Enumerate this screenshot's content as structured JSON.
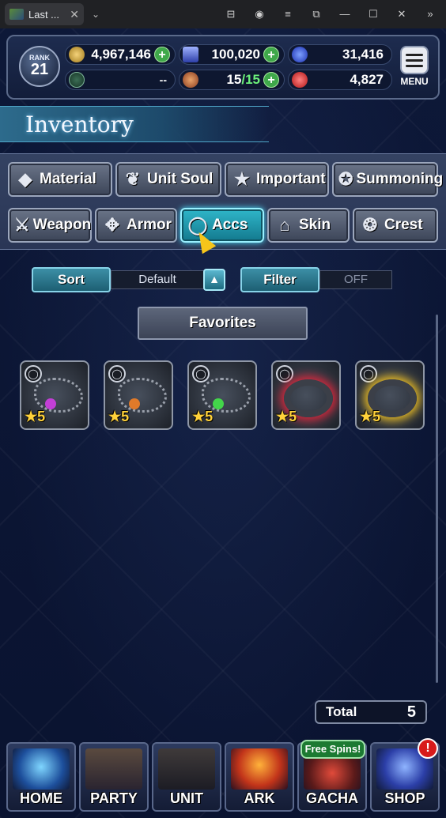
{
  "browser": {
    "tab_title": "Last ...",
    "tab_close": "✕",
    "dropdown": "⌄",
    "icons": [
      "extensions-icon",
      "profile-icon",
      "menu-icon",
      "pip-icon",
      "minimize-icon",
      "maximize-icon",
      "close-icon",
      "sidebar-icon"
    ]
  },
  "topbar": {
    "rank_label": "RANK",
    "rank_value": "21",
    "gil": "4,967,146",
    "lapis": "100,020",
    "blue_orbs": "31,416",
    "stamina_left": "--",
    "energy": "15",
    "energy_max": "/15",
    "red_orbs": "4,827",
    "menu_label": "MENU",
    "plus": "+"
  },
  "inventory": {
    "title": "Inventory",
    "categories_row1": [
      {
        "label": "Material",
        "icon": "sack-icon"
      },
      {
        "label": "Unit Soul",
        "icon": "flame-icon"
      },
      {
        "label": "Important",
        "icon": "star-icon"
      },
      {
        "label": "Summoning",
        "icon": "crest-icon"
      }
    ],
    "categories_row2": [
      {
        "label": "Weapon",
        "icon": "sword-icon"
      },
      {
        "label": "Armor",
        "icon": "armor-icon"
      },
      {
        "label": "Accs",
        "icon": "ring-icon"
      },
      {
        "label": "Skin",
        "icon": "hanger-icon"
      },
      {
        "label": "Crest",
        "icon": "emblem-icon"
      }
    ],
    "active_category": "Accs",
    "sort_label": "Sort",
    "sort_value": "Default",
    "filter_label": "Filter",
    "filter_value": "OFF",
    "favorites_label": "Favorites",
    "items": [
      {
        "stars": "★5",
        "type": "necklace",
        "gem_color": "#c23fd6"
      },
      {
        "stars": "★5",
        "type": "necklace",
        "gem_color": "#e07a2a"
      },
      {
        "stars": "★5",
        "type": "necklace",
        "gem_color": "#43d64a"
      },
      {
        "stars": "★5",
        "type": "ring",
        "glow_color": "#e0253a"
      },
      {
        "stars": "★5",
        "type": "ring",
        "glow_color": "#f0c020"
      }
    ],
    "total_label": "Total",
    "total_value": "5"
  },
  "nav": {
    "items": [
      {
        "label": "HOME"
      },
      {
        "label": "PARTY"
      },
      {
        "label": "UNIT"
      },
      {
        "label": "ARK"
      },
      {
        "label": "GACHA"
      },
      {
        "label": "SHOP"
      }
    ],
    "free_spins": "Free Spins!",
    "alert": "!"
  }
}
